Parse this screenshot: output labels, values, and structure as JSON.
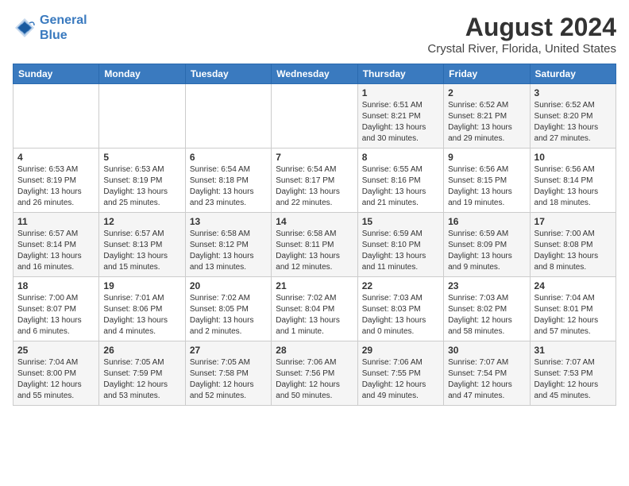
{
  "logo": {
    "line1": "General",
    "line2": "Blue"
  },
  "title": "August 2024",
  "subtitle": "Crystal River, Florida, United States",
  "days_of_week": [
    "Sunday",
    "Monday",
    "Tuesday",
    "Wednesday",
    "Thursday",
    "Friday",
    "Saturday"
  ],
  "weeks": [
    [
      {
        "day": "",
        "info": ""
      },
      {
        "day": "",
        "info": ""
      },
      {
        "day": "",
        "info": ""
      },
      {
        "day": "",
        "info": ""
      },
      {
        "day": "1",
        "info": "Sunrise: 6:51 AM\nSunset: 8:21 PM\nDaylight: 13 hours\nand 30 minutes."
      },
      {
        "day": "2",
        "info": "Sunrise: 6:52 AM\nSunset: 8:21 PM\nDaylight: 13 hours\nand 29 minutes."
      },
      {
        "day": "3",
        "info": "Sunrise: 6:52 AM\nSunset: 8:20 PM\nDaylight: 13 hours\nand 27 minutes."
      }
    ],
    [
      {
        "day": "4",
        "info": "Sunrise: 6:53 AM\nSunset: 8:19 PM\nDaylight: 13 hours\nand 26 minutes."
      },
      {
        "day": "5",
        "info": "Sunrise: 6:53 AM\nSunset: 8:19 PM\nDaylight: 13 hours\nand 25 minutes."
      },
      {
        "day": "6",
        "info": "Sunrise: 6:54 AM\nSunset: 8:18 PM\nDaylight: 13 hours\nand 23 minutes."
      },
      {
        "day": "7",
        "info": "Sunrise: 6:54 AM\nSunset: 8:17 PM\nDaylight: 13 hours\nand 22 minutes."
      },
      {
        "day": "8",
        "info": "Sunrise: 6:55 AM\nSunset: 8:16 PM\nDaylight: 13 hours\nand 21 minutes."
      },
      {
        "day": "9",
        "info": "Sunrise: 6:56 AM\nSunset: 8:15 PM\nDaylight: 13 hours\nand 19 minutes."
      },
      {
        "day": "10",
        "info": "Sunrise: 6:56 AM\nSunset: 8:14 PM\nDaylight: 13 hours\nand 18 minutes."
      }
    ],
    [
      {
        "day": "11",
        "info": "Sunrise: 6:57 AM\nSunset: 8:14 PM\nDaylight: 13 hours\nand 16 minutes."
      },
      {
        "day": "12",
        "info": "Sunrise: 6:57 AM\nSunset: 8:13 PM\nDaylight: 13 hours\nand 15 minutes."
      },
      {
        "day": "13",
        "info": "Sunrise: 6:58 AM\nSunset: 8:12 PM\nDaylight: 13 hours\nand 13 minutes."
      },
      {
        "day": "14",
        "info": "Sunrise: 6:58 AM\nSunset: 8:11 PM\nDaylight: 13 hours\nand 12 minutes."
      },
      {
        "day": "15",
        "info": "Sunrise: 6:59 AM\nSunset: 8:10 PM\nDaylight: 13 hours\nand 11 minutes."
      },
      {
        "day": "16",
        "info": "Sunrise: 6:59 AM\nSunset: 8:09 PM\nDaylight: 13 hours\nand 9 minutes."
      },
      {
        "day": "17",
        "info": "Sunrise: 7:00 AM\nSunset: 8:08 PM\nDaylight: 13 hours\nand 8 minutes."
      }
    ],
    [
      {
        "day": "18",
        "info": "Sunrise: 7:00 AM\nSunset: 8:07 PM\nDaylight: 13 hours\nand 6 minutes."
      },
      {
        "day": "19",
        "info": "Sunrise: 7:01 AM\nSunset: 8:06 PM\nDaylight: 13 hours\nand 4 minutes."
      },
      {
        "day": "20",
        "info": "Sunrise: 7:02 AM\nSunset: 8:05 PM\nDaylight: 13 hours\nand 2 minutes."
      },
      {
        "day": "21",
        "info": "Sunrise: 7:02 AM\nSunset: 8:04 PM\nDaylight: 13 hours\nand 1 minute."
      },
      {
        "day": "22",
        "info": "Sunrise: 7:03 AM\nSunset: 8:03 PM\nDaylight: 13 hours\nand 0 minutes."
      },
      {
        "day": "23",
        "info": "Sunrise: 7:03 AM\nSunset: 8:02 PM\nDaylight: 12 hours\nand 58 minutes."
      },
      {
        "day": "24",
        "info": "Sunrise: 7:04 AM\nSunset: 8:01 PM\nDaylight: 12 hours\nand 57 minutes."
      }
    ],
    [
      {
        "day": "25",
        "info": "Sunrise: 7:04 AM\nSunset: 8:00 PM\nDaylight: 12 hours\nand 55 minutes."
      },
      {
        "day": "26",
        "info": "Sunrise: 7:05 AM\nSunset: 7:59 PM\nDaylight: 12 hours\nand 53 minutes."
      },
      {
        "day": "27",
        "info": "Sunrise: 7:05 AM\nSunset: 7:58 PM\nDaylight: 12 hours\nand 52 minutes."
      },
      {
        "day": "28",
        "info": "Sunrise: 7:06 AM\nSunset: 7:56 PM\nDaylight: 12 hours\nand 50 minutes."
      },
      {
        "day": "29",
        "info": "Sunrise: 7:06 AM\nSunset: 7:55 PM\nDaylight: 12 hours\nand 49 minutes."
      },
      {
        "day": "30",
        "info": "Sunrise: 7:07 AM\nSunset: 7:54 PM\nDaylight: 12 hours\nand 47 minutes."
      },
      {
        "day": "31",
        "info": "Sunrise: 7:07 AM\nSunset: 7:53 PM\nDaylight: 12 hours\nand 45 minutes."
      }
    ]
  ]
}
